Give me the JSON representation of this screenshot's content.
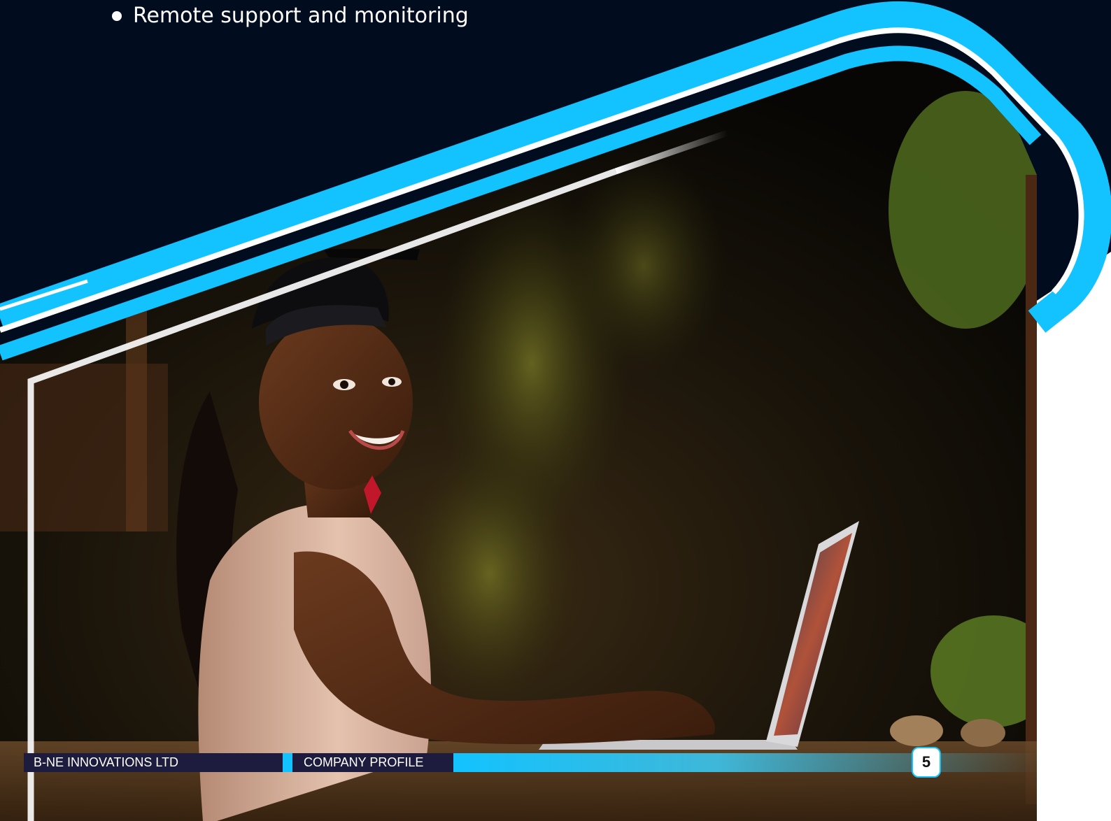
{
  "bullet_text": "Remote support and monitoring",
  "footer": {
    "company": "B-NE INNOVATIONS LTD",
    "document": "COMPANY PROFILE",
    "page_number": "5"
  },
  "colors": {
    "navy": "#020c1f",
    "cyan": "#13c3ff",
    "footer_bar": "#1d1c3e"
  },
  "icons": [
    "bullet-dot-icon"
  ]
}
